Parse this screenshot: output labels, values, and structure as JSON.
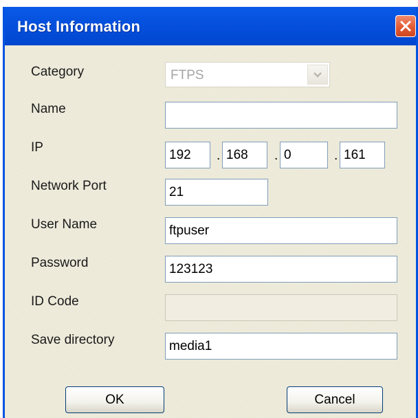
{
  "dialog": {
    "title": "Host Information",
    "close_label": "×"
  },
  "form": {
    "category": {
      "label": "Category",
      "value": "FTPS",
      "disabled": true
    },
    "name": {
      "label": "Name",
      "value": ""
    },
    "ip": {
      "label": "IP",
      "octets": [
        "192",
        "168",
        "0",
        "161"
      ],
      "separator": "."
    },
    "network_port": {
      "label": "Network Port",
      "value": "21"
    },
    "user_name": {
      "label": "User Name",
      "value": "ftpuser"
    },
    "password": {
      "label": "Password",
      "value": "123123"
    },
    "id_code": {
      "label": "ID Code",
      "value": "",
      "disabled": true
    },
    "save_directory": {
      "label": "Save directory",
      "value": "media1"
    }
  },
  "buttons": {
    "ok_label": "OK",
    "cancel_label": "Cancel"
  },
  "icons": {
    "close": "close-icon",
    "dropdown": "chevron-down-icon"
  },
  "colors": {
    "titlebar": "#0550dc",
    "close_button": "#e25b34",
    "dialog_bg": "#ece9d8",
    "field_border": "#7f9db9"
  }
}
